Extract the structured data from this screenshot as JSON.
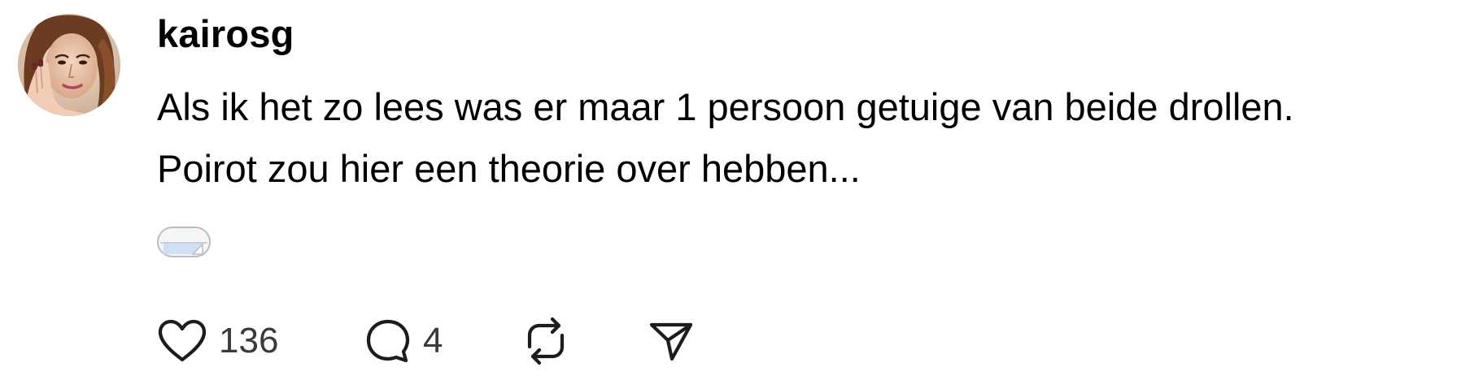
{
  "post": {
    "username": "kairosg",
    "text_lines": [
      "Als ik het zo lees was er maar 1 persoon getuige van beide drollen.",
      "Poirot zou hier een theorie over hebben..."
    ],
    "media_icon": "sticker-thumbnail-icon",
    "actions": {
      "like": {
        "icon": "heart-icon",
        "count": "136"
      },
      "reply": {
        "icon": "comment-bubble-icon",
        "count": "4"
      },
      "repost": {
        "icon": "repost-icon"
      },
      "share": {
        "icon": "send-icon"
      }
    }
  },
  "colors": {
    "text": "#000000",
    "count_text": "#3a3a3a",
    "icon_stroke": "#1c1c1c",
    "background": "#ffffff"
  }
}
